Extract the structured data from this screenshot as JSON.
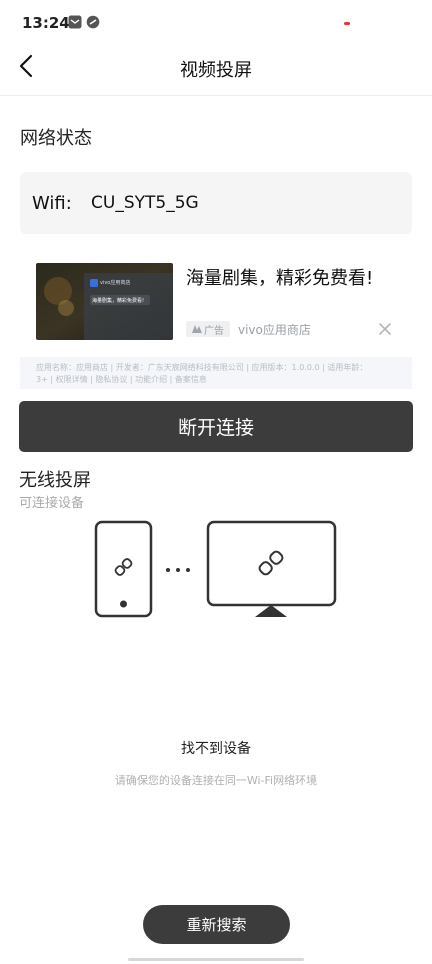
{
  "status_bar": {
    "time": "13:24"
  },
  "header": {
    "title": "视频投屏",
    "back_icon": "back-chevron-icon"
  },
  "network": {
    "section_label": "网络状态",
    "wifi_label": "Wifi:",
    "wifi_value": "CU_SYT5_5G"
  },
  "ad": {
    "title": "海量剧集，精彩免费看!",
    "tag": "广告",
    "source": "vivo应用商店",
    "image_caption": "海量剧集，精彩免费看!",
    "image_app_name": "vivo应用商店",
    "info_line1": "应用名称：应用商店 | 开发者：广东天宸网络科技有限公司 | 应用版本：1.0.0.0 | 适用年龄：",
    "info_line2": "3+ | 权限详情 | 隐私协议 | 功能介绍 | 备案信息"
  },
  "disconnect_label": "断开连接",
  "wireless": {
    "title": "无线投屏",
    "subtitle": "可连接设备",
    "dots": "···"
  },
  "empty_state": {
    "title": "找不到设备",
    "hint": "请确保您的设备连接在同一Wi-Fi网络环境"
  },
  "research_label": "重新搜索",
  "colors": {
    "dark_button": "#3c3c3c",
    "wifi_box": "#f5f5f5",
    "ad_info_bg": "#f4f6f9"
  }
}
